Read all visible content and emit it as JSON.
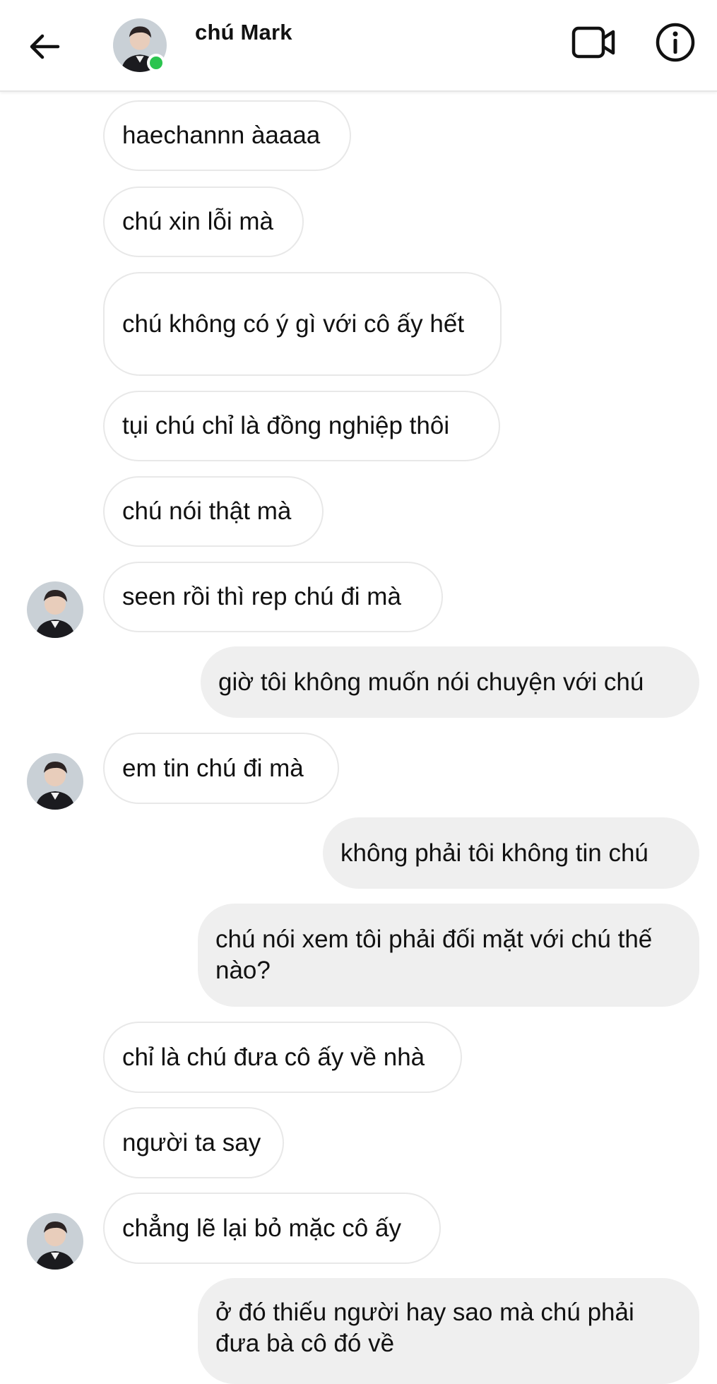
{
  "header": {
    "contact_name": "chú Mark",
    "icons": {
      "back": "back-arrow-icon",
      "video": "video-call-icon",
      "info": "info-icon"
    },
    "status_color": "#2ac44e"
  },
  "messages": [
    {
      "direction": "in",
      "text": "haechannn àaaaa"
    },
    {
      "direction": "in",
      "text": "chú xin lỗi mà"
    },
    {
      "direction": "in",
      "text": "chú không có ý gì với cô ấy hết"
    },
    {
      "direction": "in",
      "text": "tụi chú chỉ là đồng nghiệp thôi"
    },
    {
      "direction": "in",
      "text": "chú nói thật mà"
    },
    {
      "direction": "in",
      "text": "seen rồi thì rep chú đi mà"
    },
    {
      "direction": "out",
      "text": "giờ tôi không muốn nói chuyện với chú"
    },
    {
      "direction": "in",
      "text": "em tin chú đi mà"
    },
    {
      "direction": "out",
      "text": "không phải tôi không tin chú"
    },
    {
      "direction": "out",
      "text": "chú nói xem tôi phải đối mặt với chú thế nào?"
    },
    {
      "direction": "in",
      "text": "chỉ là chú đưa cô ấy về nhà"
    },
    {
      "direction": "in",
      "text": "người ta say"
    },
    {
      "direction": "in",
      "text": "chẳng lẽ lại bỏ mặc cô ấy"
    },
    {
      "direction": "out",
      "text": "ở đó thiếu người hay sao mà chú phải đưa bà cô đó về"
    }
  ]
}
